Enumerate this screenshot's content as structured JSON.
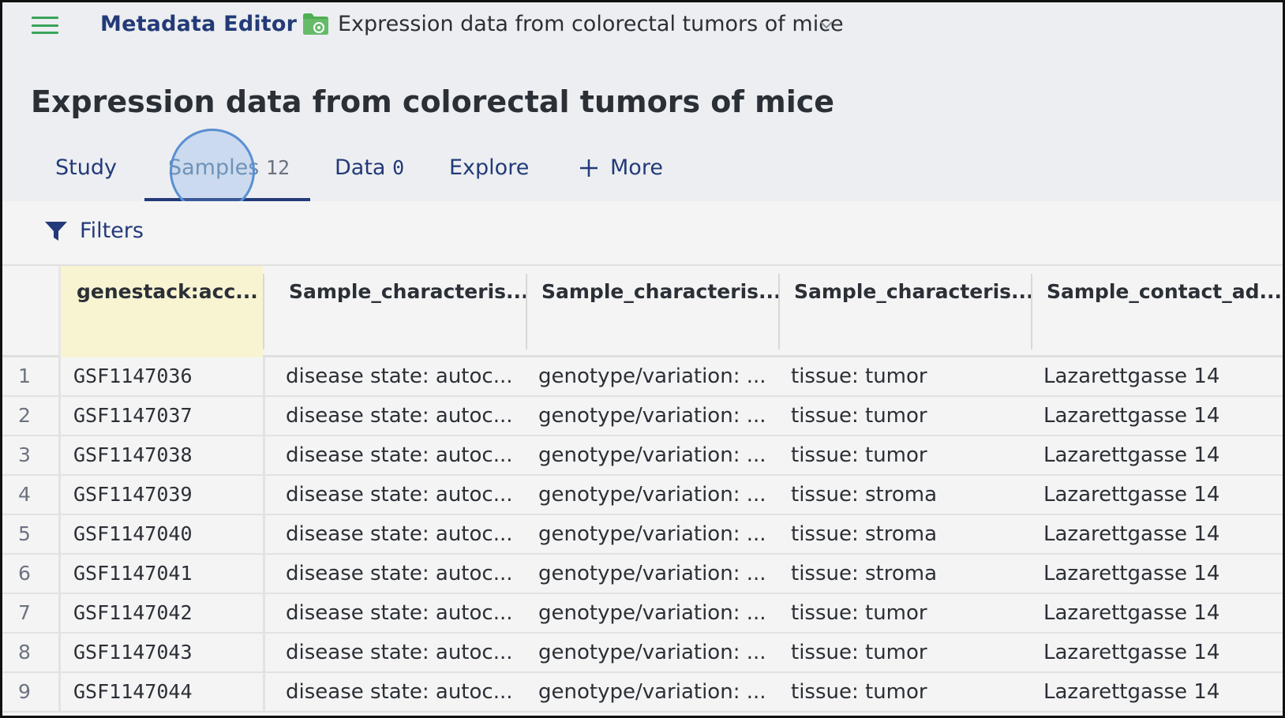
{
  "header": {
    "app_title": "Metadata Editor",
    "breadcrumb_title": "Expression data from colorectal tumors of mice"
  },
  "page": {
    "title": "Expression data from colorectal tumors of mice"
  },
  "tabs": [
    {
      "label": "Study",
      "count": ""
    },
    {
      "label": "Samples",
      "count": "12"
    },
    {
      "label": "Data",
      "count": "0"
    },
    {
      "label": "Explore",
      "count": ""
    },
    {
      "label": "More",
      "count": ""
    }
  ],
  "active_tab": "Samples",
  "filters": {
    "label": "Filters"
  },
  "colors": {
    "accent": "#233a78",
    "menu_green": "#3aa35a",
    "highlight_column": "#f8f4d2"
  },
  "table": {
    "columns": [
      "genestack:acc...",
      "Sample_characteris...",
      "Sample_characteris...",
      "Sample_characteris...",
      "Sample_contact_ad..."
    ],
    "rows": [
      {
        "n": "1",
        "cells": [
          "GSF1147036",
          "disease state: autoc...",
          "genotype/variation: ...",
          "tissue: tumor",
          "Lazarettgasse 14"
        ]
      },
      {
        "n": "2",
        "cells": [
          "GSF1147037",
          "disease state: autoc...",
          "genotype/variation: ...",
          "tissue: tumor",
          "Lazarettgasse 14"
        ]
      },
      {
        "n": "3",
        "cells": [
          "GSF1147038",
          "disease state: autoc...",
          "genotype/variation: ...",
          "tissue: tumor",
          "Lazarettgasse 14"
        ]
      },
      {
        "n": "4",
        "cells": [
          "GSF1147039",
          "disease state: autoc...",
          "genotype/variation: ...",
          "tissue: stroma",
          "Lazarettgasse 14"
        ]
      },
      {
        "n": "5",
        "cells": [
          "GSF1147040",
          "disease state: autoc...",
          "genotype/variation: ...",
          "tissue: stroma",
          "Lazarettgasse 14"
        ]
      },
      {
        "n": "6",
        "cells": [
          "GSF1147041",
          "disease state: autoc...",
          "genotype/variation: ...",
          "tissue: stroma",
          "Lazarettgasse 14"
        ]
      },
      {
        "n": "7",
        "cells": [
          "GSF1147042",
          "disease state: autoc...",
          "genotype/variation: ...",
          "tissue: tumor",
          "Lazarettgasse 14"
        ]
      },
      {
        "n": "8",
        "cells": [
          "GSF1147043",
          "disease state: autoc...",
          "genotype/variation: ...",
          "tissue: tumor",
          "Lazarettgasse 14"
        ]
      },
      {
        "n": "9",
        "cells": [
          "GSF1147044",
          "disease state: autoc...",
          "genotype/variation: ...",
          "tissue: tumor",
          "Lazarettgasse 14"
        ]
      }
    ]
  }
}
